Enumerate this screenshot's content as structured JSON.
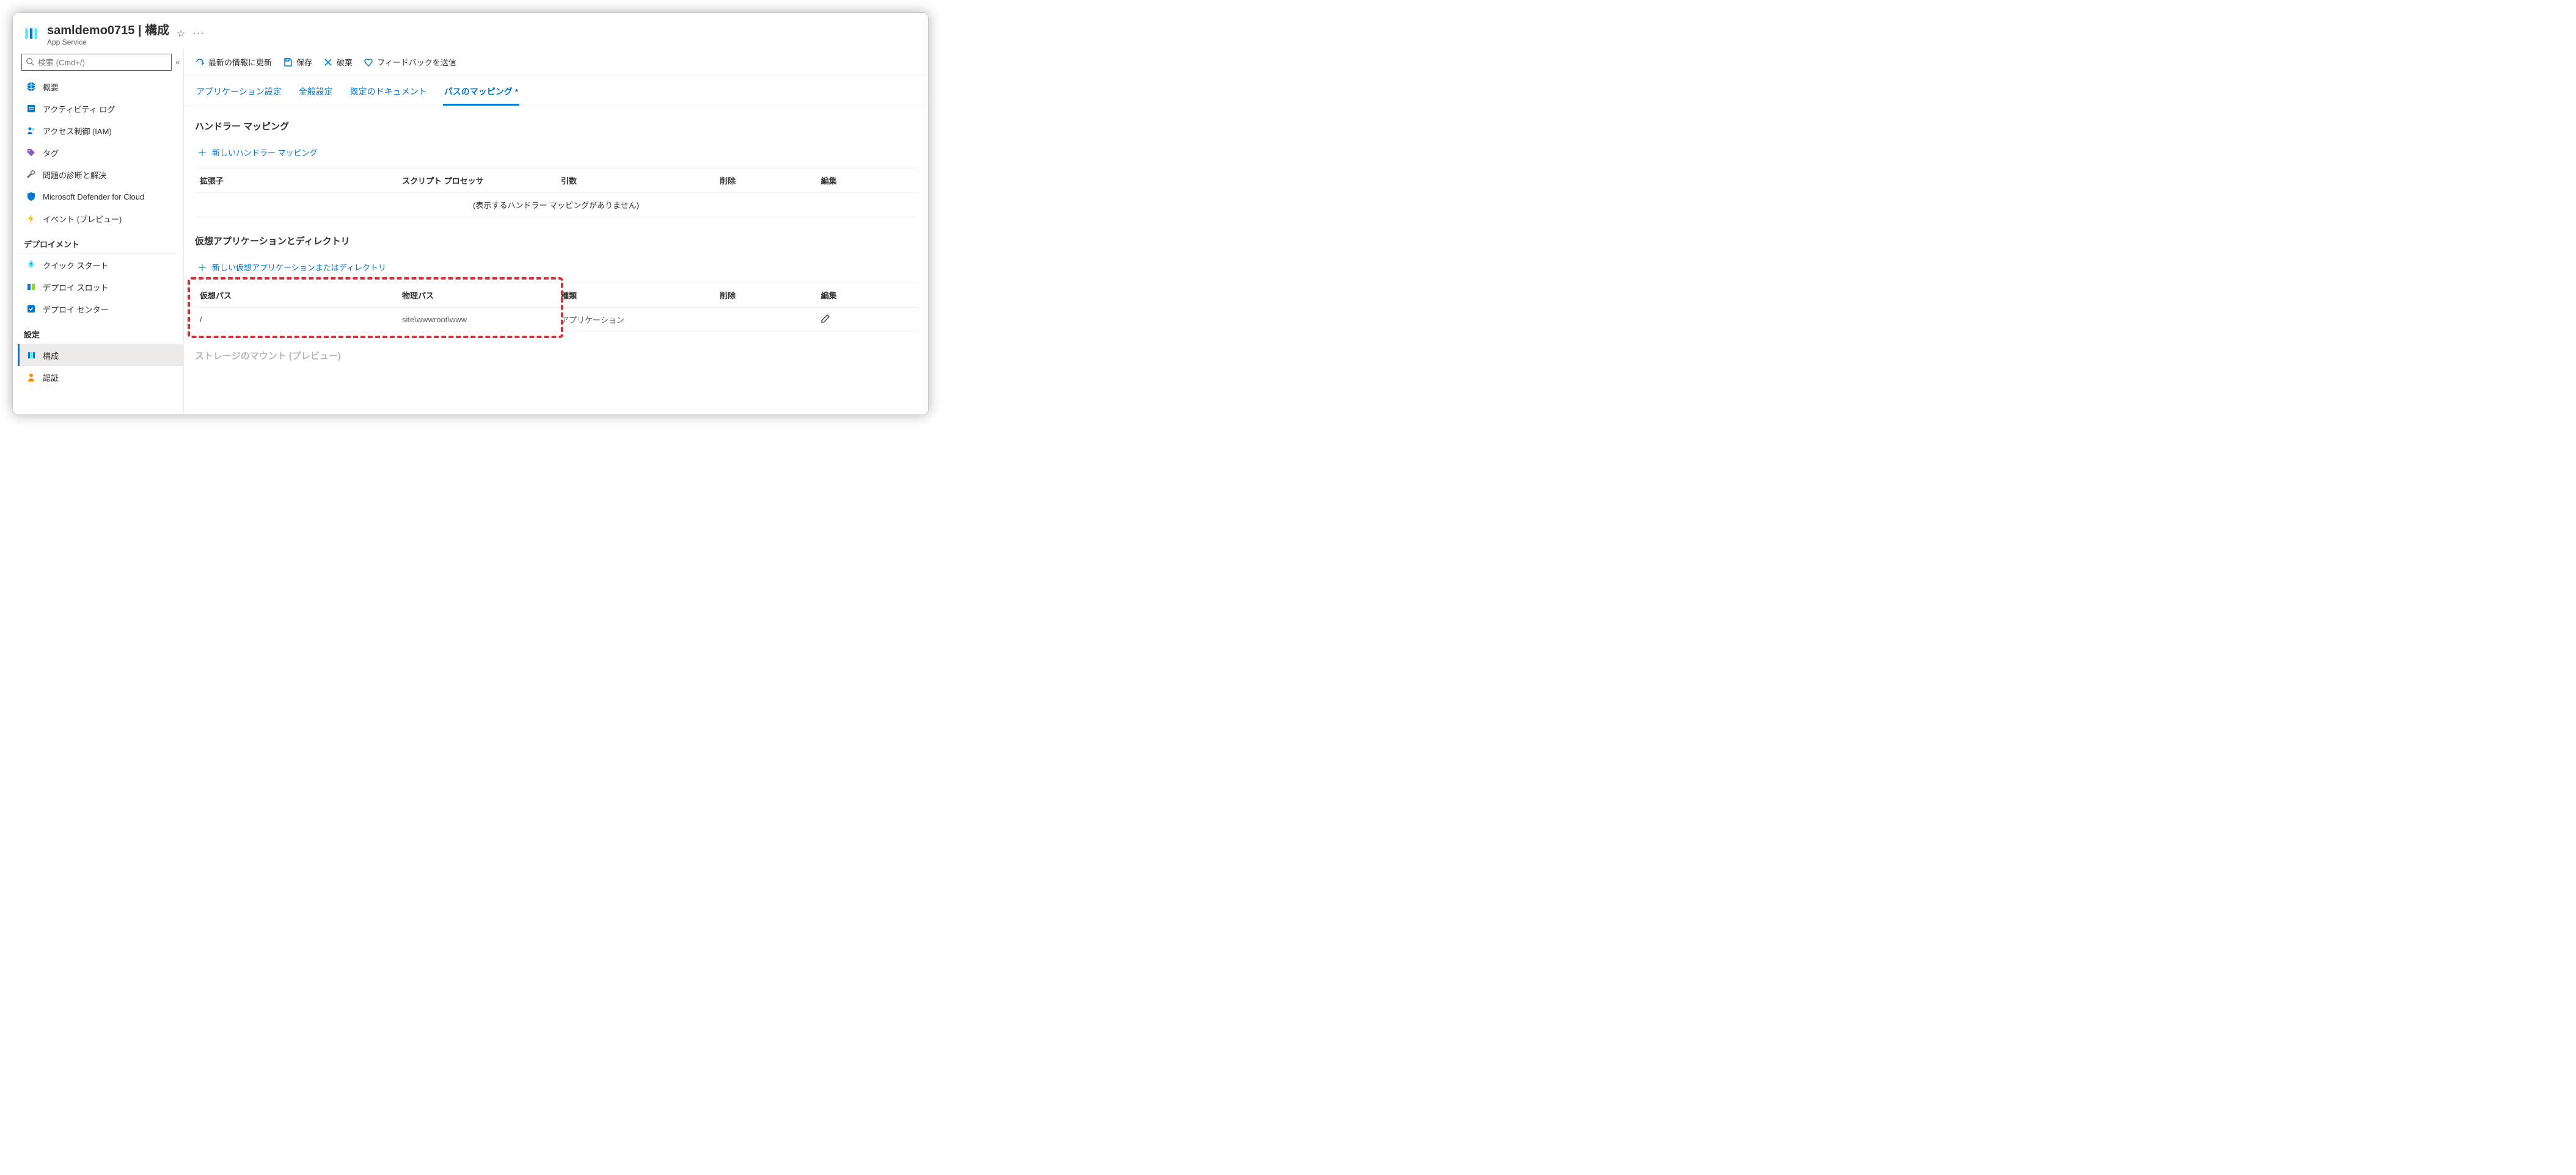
{
  "header": {
    "title": "samldemo0715 | 構成",
    "subtitle": "App Service"
  },
  "search": {
    "placeholder": "検索 (Cmd+/)"
  },
  "sidebar": {
    "items": [
      {
        "id": "overview",
        "label": "概要"
      },
      {
        "id": "activity",
        "label": "アクティビティ ログ"
      },
      {
        "id": "iam",
        "label": "アクセス制御 (IAM)"
      },
      {
        "id": "tags",
        "label": "タグ"
      },
      {
        "id": "diagnose",
        "label": "問題の診断と解決"
      },
      {
        "id": "defender",
        "label": "Microsoft Defender for Cloud"
      },
      {
        "id": "events",
        "label": "イベント (プレビュー)"
      }
    ],
    "group_deploy": "デプロイメント",
    "deploy": [
      {
        "id": "quickstart",
        "label": "クイック スタート"
      },
      {
        "id": "slots",
        "label": "デプロイ スロット"
      },
      {
        "id": "deploycenter",
        "label": "デプロイ センター"
      }
    ],
    "group_settings": "設定",
    "settings": [
      {
        "id": "config",
        "label": "構成",
        "active": true
      },
      {
        "id": "auth",
        "label": "認証"
      }
    ]
  },
  "toolbar": {
    "refresh": "最新の情報に更新",
    "save": "保存",
    "discard": "破棄",
    "feedback": "フィードバックを送信"
  },
  "tabs": {
    "app_settings": "アプリケーション設定",
    "general": "全般設定",
    "default_docs": "既定のドキュメント",
    "path_mappings": "パスのマッピング",
    "dirty_marker": "*"
  },
  "handler": {
    "title": "ハンドラー マッピング",
    "add": "新しいハンドラー マッピング",
    "cols": {
      "ext": "拡張子",
      "script": "スクリプト プロセッサ",
      "args": "引数",
      "del": "削除",
      "edit": "編集"
    },
    "empty": "(表示するハンドラー マッピングがありません)"
  },
  "vdir": {
    "title": "仮想アプリケーションとディレクトリ",
    "add": "新しい仮想アプリケーションまたはディレクトリ",
    "cols": {
      "vpath": "仮想パス",
      "ppath": "物理パス",
      "kind": "種類",
      "del": "削除",
      "edit": "編集"
    },
    "rows": [
      {
        "vpath": "/",
        "ppath": "site\\wwwroot\\www",
        "kind": "アプリケーション"
      }
    ]
  },
  "storage": {
    "title_partial": "ストレージのマウント (プレビュー)"
  }
}
